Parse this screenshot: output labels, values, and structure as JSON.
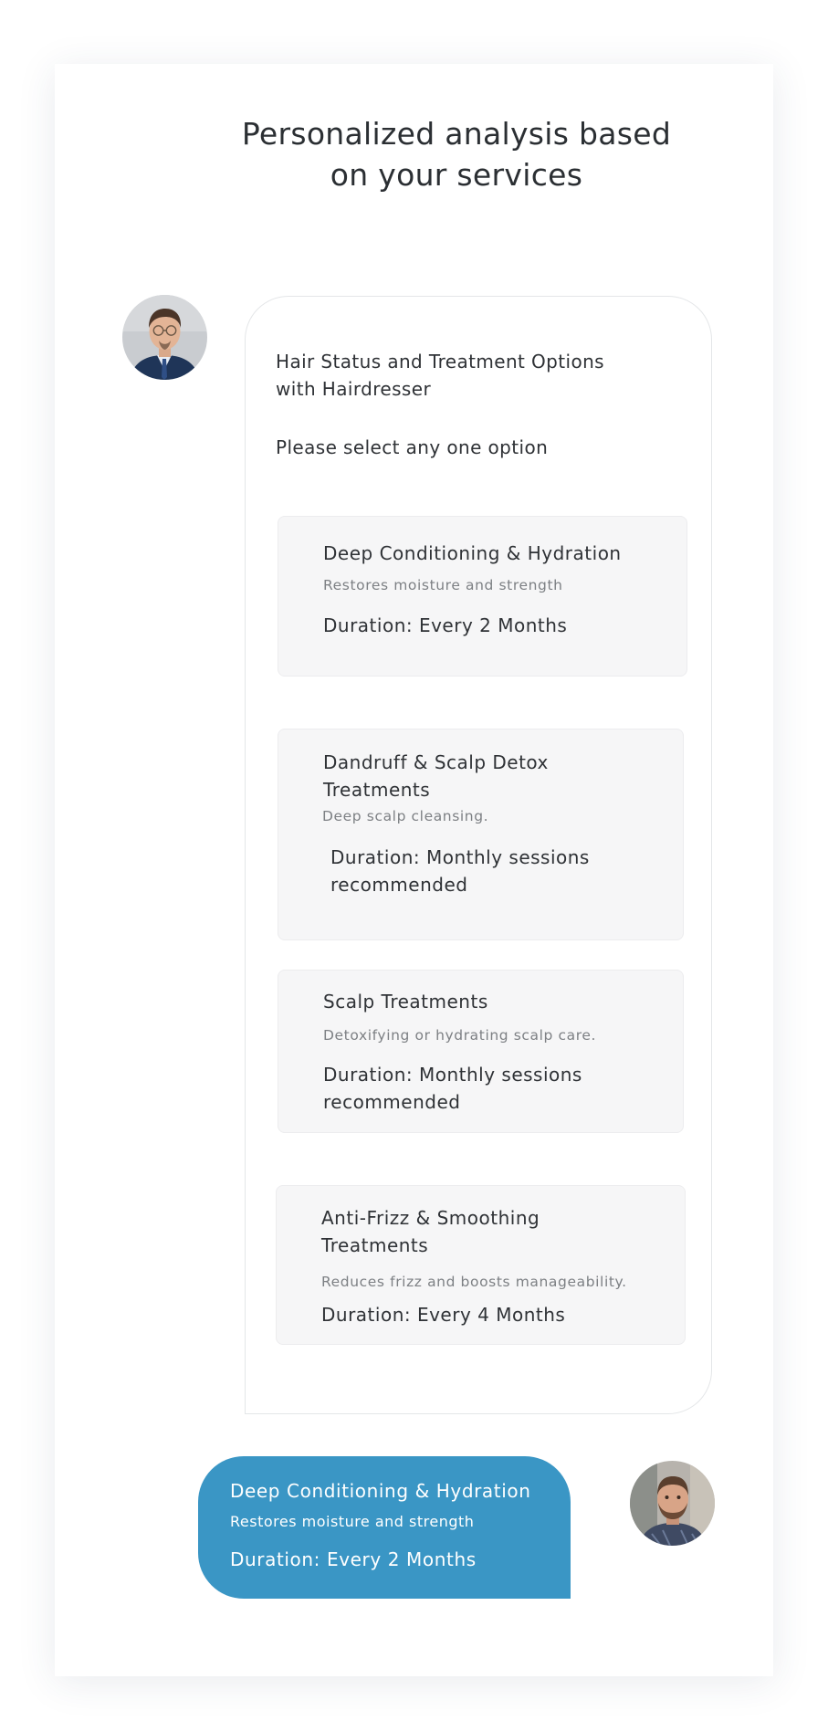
{
  "page": {
    "title_line1": "Personalized analysis based",
    "title_line2": "on your services"
  },
  "agent_message": {
    "heading": "Hair Status and Treatment Options with Hairdresser",
    "instruction": "Please select any one option",
    "options": [
      {
        "title": "Deep Conditioning & Hydration",
        "description": "Restores moisture and strength",
        "duration": "Duration: Every 2 Months"
      },
      {
        "title": "Dandruff & Scalp Detox Treatments",
        "description": "Deep scalp cleansing.",
        "duration": "Duration: Monthly sessions recommended"
      },
      {
        "title": "Scalp Treatments",
        "description": "Detoxifying or hydrating scalp care.",
        "duration": "Duration: Monthly sessions recommended"
      },
      {
        "title": "Anti-Frizz & Smoothing Treatments",
        "description": "Reduces frizz and boosts manageability.",
        "duration": "Duration: Every 4 Months"
      }
    ]
  },
  "user_message": {
    "title": "Deep Conditioning & Hydration",
    "description": "Restores moisture and strength",
    "duration": "Duration: Every 2 Months"
  },
  "avatars": {
    "agent": "avatar-hairdresser-photo",
    "user": "avatar-user-photo"
  },
  "colors": {
    "user_bubble": "#3a96c5",
    "option_background": "#f6f6f7",
    "text_primary": "#2f3236",
    "text_secondary": "#7d8084"
  }
}
